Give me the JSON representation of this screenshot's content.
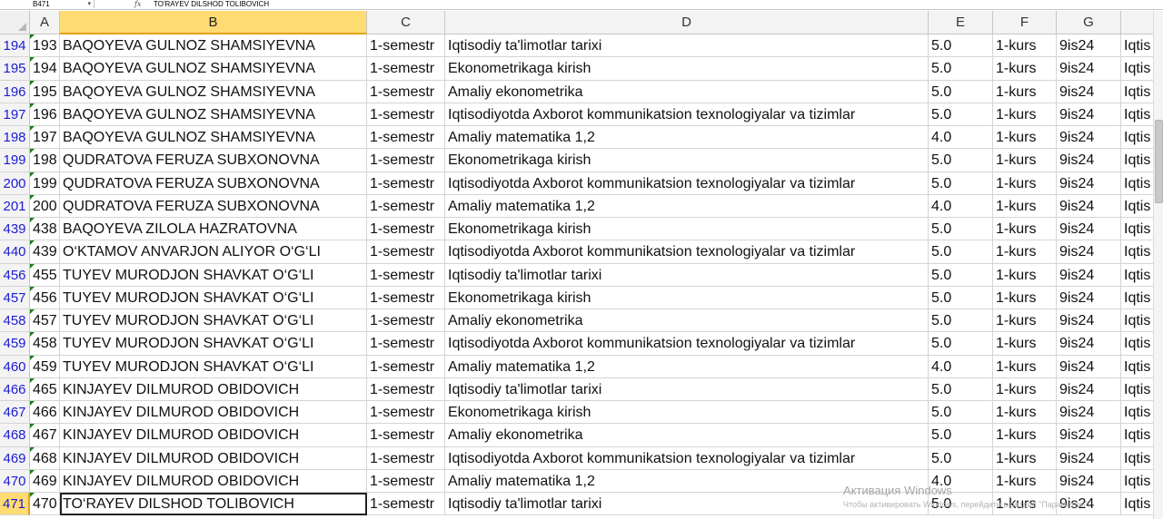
{
  "formula_bar": {
    "name_box": "B471",
    "fx_label": "fx",
    "value": "TO'RAYEV DILSHOD TOLIBOVICH"
  },
  "columns": [
    "A",
    "B",
    "C",
    "D",
    "E",
    "F",
    "G"
  ],
  "active_column": "B",
  "rows": [
    {
      "num": "194",
      "a": "193",
      "b": "BAQOYEVA GULNOZ SHAMSIYEVNA",
      "c": "1-semestr",
      "d": "Iqtisodiy ta'limotlar tarixi",
      "e": "5.0",
      "f": "1-kurs",
      "g": "9is24",
      "h": "Iqtis"
    },
    {
      "num": "195",
      "a": "194",
      "b": "BAQOYEVA GULNOZ SHAMSIYEVNA",
      "c": "1-semestr",
      "d": "Ekonometrikaga kirish",
      "e": "5.0",
      "f": "1-kurs",
      "g": "9is24",
      "h": "Iqtis"
    },
    {
      "num": "196",
      "a": "195",
      "b": "BAQOYEVA GULNOZ SHAMSIYEVNA",
      "c": "1-semestr",
      "d": "Amaliy ekonometrika",
      "e": "5.0",
      "f": "1-kurs",
      "g": "9is24",
      "h": "Iqtis"
    },
    {
      "num": "197",
      "a": "196",
      "b": "BAQOYEVA GULNOZ SHAMSIYEVNA",
      "c": "1-semestr",
      "d": "Iqtisodiyotda Axborot kommunikatsion texnologiyalar va tizimlar",
      "e": "5.0",
      "f": "1-kurs",
      "g": "9is24",
      "h": "Iqtis"
    },
    {
      "num": "198",
      "a": "197",
      "b": "BAQOYEVA GULNOZ SHAMSIYEVNA",
      "c": "1-semestr",
      "d": "Amaliy matematika 1,2",
      "e": "4.0",
      "f": "1-kurs",
      "g": "9is24",
      "h": "Iqtis"
    },
    {
      "num": "199",
      "a": "198",
      "b": "QUDRATOVA FERUZA SUBXONOVNA",
      "c": "1-semestr",
      "d": "Ekonometrikaga kirish",
      "e": "5.0",
      "f": "1-kurs",
      "g": "9is24",
      "h": "Iqtis"
    },
    {
      "num": "200",
      "a": "199",
      "b": "QUDRATOVA FERUZA SUBXONOVNA",
      "c": "1-semestr",
      "d": "Iqtisodiyotda Axborot kommunikatsion texnologiyalar va tizimlar",
      "e": "5.0",
      "f": "1-kurs",
      "g": "9is24",
      "h": "Iqtis"
    },
    {
      "num": "201",
      "a": "200",
      "b": "QUDRATOVA FERUZA SUBXONOVNA",
      "c": "1-semestr",
      "d": "Amaliy matematika 1,2",
      "e": "4.0",
      "f": "1-kurs",
      "g": "9is24",
      "h": "Iqtis"
    },
    {
      "num": "439",
      "a": "438",
      "b": "BAQOYEVA ZILOLA HAZRATOVNA",
      "c": "1-semestr",
      "d": "Ekonometrikaga kirish",
      "e": "5.0",
      "f": "1-kurs",
      "g": "9is24",
      "h": "Iqtis"
    },
    {
      "num": "440",
      "a": "439",
      "b": "O‘KTAMOV ANVARJON ALIYOR O‘G‘LI",
      "c": "1-semestr",
      "d": "Iqtisodiyotda Axborot kommunikatsion texnologiyalar va tizimlar",
      "e": "5.0",
      "f": "1-kurs",
      "g": "9is24",
      "h": "Iqtis"
    },
    {
      "num": "456",
      "a": "455",
      "b": "TUYEV MURODJON SHAVKAT O‘G‘LI",
      "c": "1-semestr",
      "d": "Iqtisodiy ta'limotlar tarixi",
      "e": "5.0",
      "f": "1-kurs",
      "g": "9is24",
      "h": "Iqtis"
    },
    {
      "num": "457",
      "a": "456",
      "b": "TUYEV MURODJON SHAVKAT O‘G‘LI",
      "c": "1-semestr",
      "d": "Ekonometrikaga kirish",
      "e": "5.0",
      "f": "1-kurs",
      "g": "9is24",
      "h": "Iqtis"
    },
    {
      "num": "458",
      "a": "457",
      "b": "TUYEV MURODJON SHAVKAT O‘G‘LI",
      "c": "1-semestr",
      "d": "Amaliy ekonometrika",
      "e": "5.0",
      "f": "1-kurs",
      "g": "9is24",
      "h": "Iqtis"
    },
    {
      "num": "459",
      "a": "458",
      "b": "TUYEV MURODJON SHAVKAT O‘G‘LI",
      "c": "1-semestr",
      "d": "Iqtisodiyotda Axborot kommunikatsion texnologiyalar va tizimlar",
      "e": "5.0",
      "f": "1-kurs",
      "g": "9is24",
      "h": "Iqtis"
    },
    {
      "num": "460",
      "a": "459",
      "b": "TUYEV MURODJON SHAVKAT O‘G‘LI",
      "c": "1-semestr",
      "d": "Amaliy matematika 1,2",
      "e": "4.0",
      "f": "1-kurs",
      "g": "9is24",
      "h": "Iqtis"
    },
    {
      "num": "466",
      "a": "465",
      "b": "KINJAYEV DILMUROD OBIDOVICH",
      "c": "1-semestr",
      "d": "Iqtisodiy ta'limotlar tarixi",
      "e": "5.0",
      "f": "1-kurs",
      "g": "9is24",
      "h": "Iqtis"
    },
    {
      "num": "467",
      "a": "466",
      "b": "KINJAYEV DILMUROD OBIDOVICH",
      "c": "1-semestr",
      "d": "Ekonometrikaga kirish",
      "e": "5.0",
      "f": "1-kurs",
      "g": "9is24",
      "h": "Iqtis"
    },
    {
      "num": "468",
      "a": "467",
      "b": "KINJAYEV DILMUROD OBIDOVICH",
      "c": "1-semestr",
      "d": "Amaliy ekonometrika",
      "e": "5.0",
      "f": "1-kurs",
      "g": "9is24",
      "h": "Iqtis"
    },
    {
      "num": "469",
      "a": "468",
      "b": "KINJAYEV DILMUROD OBIDOVICH",
      "c": "1-semestr",
      "d": "Iqtisodiyotda Axborot kommunikatsion texnologiyalar va tizimlar",
      "e": "5.0",
      "f": "1-kurs",
      "g": "9is24",
      "h": "Iqtis"
    },
    {
      "num": "470",
      "a": "469",
      "b": "KINJAYEV DILMUROD OBIDOVICH",
      "c": "1-semestr",
      "d": "Amaliy matematika 1,2",
      "e": "4.0",
      "f": "1-kurs",
      "g": "9is24",
      "h": "Iqtis"
    },
    {
      "num": "471",
      "a": "470",
      "b": "TO‘RAYEV DILSHOD TOLIBOVICH",
      "c": "1-semestr",
      "d": "Iqtisodiy ta'limotlar tarixi",
      "e": "5.0",
      "f": "1-kurs",
      "g": "9is24",
      "h": "Iqtis"
    }
  ],
  "active_row": "471",
  "watermark": {
    "title": "Активация Windows",
    "subtitle": "Чтобы активировать Windows, перейдите в раздел \"Параметры\"."
  }
}
